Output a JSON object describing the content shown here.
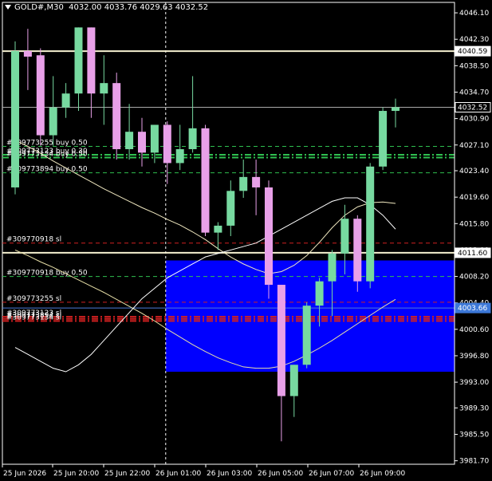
{
  "header": {
    "symbol": "GOLD#,M30",
    "ohlc": "4032.00 4033.76 4029.63 4032.52"
  },
  "colors": {
    "background": "#000000",
    "bull": "#77d9a0",
    "bear": "#e8a0e8",
    "zone": "#0000ff",
    "axis": "#ffffff",
    "grid_dash": "#ffffff",
    "buy_line": "#2fbf4f",
    "sl_line": "#d02020"
  },
  "chart_data": {
    "type": "candlestick",
    "y_ticks": [
      "4046.10",
      "4042.30",
      "4038.50",
      "4034.70",
      "4030.90",
      "4027.10",
      "4023.40",
      "4019.60",
      "4015.80",
      "4012.00",
      "4008.20",
      "4004.40",
      "4000.60",
      "3996.80",
      "3993.00",
      "3989.30",
      "3985.50",
      "3981.70"
    ],
    "x_ticks": [
      "25 Jun 2026",
      "25 Jun 20:00",
      "25 Jun 22:00",
      "26 Jun 01:00",
      "26 Jun 03:00",
      "26 Jun 05:00",
      "26 Jun 07:00",
      "26 Jun 09:00"
    ],
    "ylim": [
      3981.2,
      4047.6
    ],
    "price_labels": [
      {
        "value": 4040.59,
        "text": "4040.59",
        "style": "white-line"
      },
      {
        "value": 4032.52,
        "text": "4032.52",
        "style": "current"
      },
      {
        "value": 4011.6,
        "text": "4011.60",
        "style": "white-line"
      },
      {
        "value": 4003.66,
        "text": "4003.66",
        "style": "blue-line"
      }
    ],
    "candles": [
      {
        "o": 4021.0,
        "h": 4042.0,
        "l": 4020.0,
        "c": 4040.6
      },
      {
        "o": 4040.6,
        "h": 4043.8,
        "l": 4035.0,
        "c": 4039.8
      },
      {
        "o": 4040.0,
        "h": 4041.0,
        "l": 4027.0,
        "c": 4028.5
      },
      {
        "o": 4028.5,
        "h": 4037.0,
        "l": 4027.0,
        "c": 4032.5
      },
      {
        "o": 4032.5,
        "h": 4036.0,
        "l": 4031.0,
        "c": 4034.5
      },
      {
        "o": 4034.5,
        "h": 4044.0,
        "l": 4032.0,
        "c": 4044.0
      },
      {
        "o": 4044.0,
        "h": 4044.0,
        "l": 4031.0,
        "c": 4034.5
      },
      {
        "o": 4034.5,
        "h": 4040.0,
        "l": 4030.0,
        "c": 4036.0
      },
      {
        "o": 4036.0,
        "h": 4037.5,
        "l": 4025.0,
        "c": 4026.5
      },
      {
        "o": 4026.5,
        "h": 4033.0,
        "l": 4025.0,
        "c": 4029.0
      },
      {
        "o": 4029.0,
        "h": 4031.0,
        "l": 4024.0,
        "c": 4026.0
      },
      {
        "o": 4026.0,
        "h": 4030.0,
        "l": 4024.5,
        "c": 4030.0
      },
      {
        "o": 4030.0,
        "h": 4030.5,
        "l": 4021.5,
        "c": 4024.5
      },
      {
        "o": 4024.5,
        "h": 4030.0,
        "l": 4023.5,
        "c": 4026.5
      },
      {
        "o": 4026.5,
        "h": 4037.0,
        "l": 4026.0,
        "c": 4029.5
      },
      {
        "o": 4029.5,
        "h": 4030.0,
        "l": 4014.0,
        "c": 4014.5
      },
      {
        "o": 4014.5,
        "h": 4016.0,
        "l": 4012.0,
        "c": 4015.5
      },
      {
        "o": 4015.5,
        "h": 4022.0,
        "l": 4014.0,
        "c": 4020.5
      },
      {
        "o": 4020.5,
        "h": 4025.0,
        "l": 4019.5,
        "c": 4022.5
      },
      {
        "o": 4022.5,
        "h": 4025.0,
        "l": 4017.0,
        "c": 4021.0
      },
      {
        "o": 4021.0,
        "h": 4022.0,
        "l": 4005.0,
        "c": 4007.0
      },
      {
        "o": 4007.0,
        "h": 4007.0,
        "l": 3984.5,
        "c": 3991.0
      },
      {
        "o": 3991.0,
        "h": 3995.5,
        "l": 3988.0,
        "c": 3995.5
      },
      {
        "o": 3995.5,
        "h": 4004.5,
        "l": 3995.0,
        "c": 4004.0
      },
      {
        "o": 4004.0,
        "h": 4008.0,
        "l": 4001.0,
        "c": 4007.5
      },
      {
        "o": 4007.5,
        "h": 4012.0,
        "l": 4002.5,
        "c": 4011.5
      },
      {
        "o": 4011.5,
        "h": 4018.5,
        "l": 4008.5,
        "c": 4016.5
      },
      {
        "o": 4016.5,
        "h": 4017.0,
        "l": 4006.0,
        "c": 4007.5
      },
      {
        "o": 4007.5,
        "h": 4024.5,
        "l": 4006.5,
        "c": 4024.0
      },
      {
        "o": 4024.0,
        "h": 4032.5,
        "l": 4023.5,
        "c": 4032.0
      },
      {
        "o": 4032.0,
        "h": 4033.76,
        "l": 4029.63,
        "c": 4032.52
      }
    ],
    "ma_slow": [
      4012.0,
      4011.2,
      4010.3,
      4009.5,
      4008.6,
      4007.7,
      4006.8,
      4005.9,
      4004.9,
      4003.9,
      4002.9,
      4001.8,
      4000.6,
      3999.5,
      3998.4,
      3997.4,
      3996.5,
      3995.8,
      3995.2,
      3995.0,
      3995.0,
      3995.3,
      3996.0,
      3996.9,
      3997.9,
      3999.0,
      4000.2,
      4001.4,
      4002.6,
      4003.8,
      4004.9
    ],
    "ma_fast": [
      4027.8,
      4026.9,
      4025.9,
      4024.8,
      4023.8,
      4022.8,
      4021.8,
      4020.8,
      4019.9,
      4019.0,
      4018.1,
      4017.3,
      4016.4,
      4015.6,
      4014.6,
      4013.5,
      4012.2,
      4011.0,
      4010.0,
      4009.2,
      4008.6,
      4008.9,
      4009.8,
      4011.2,
      4013.1,
      4015.2,
      4017.0,
      4018.2,
      4018.8,
      4018.9,
      4018.7
    ],
    "ma_third": [
      3998.0,
      3997.0,
      3996.0,
      3995.0,
      3994.5,
      3995.5,
      3997.0,
      3999.0,
      4001.0,
      4003.0,
      4005.0,
      4006.5,
      4008.0,
      4009.0,
      4010.0,
      4011.0,
      4011.5,
      4012.0,
      4012.5,
      4013.0,
      4014.0,
      4015.0,
      4016.0,
      4017.0,
      4018.0,
      4019.0,
      4019.5,
      4019.5,
      4018.5,
      4017.0,
      4015.0
    ],
    "zone": {
      "top": 4010.5,
      "bottom": 3994.5,
      "start_index": 12
    },
    "vertical_marker_index": 12,
    "trade_lines": [
      {
        "value": 4026.9,
        "label": "#309773255 buy 0.50",
        "kind": "buy-dash"
      },
      {
        "value": 4025.7,
        "label": "#309773123 buy 0.30",
        "kind": "buy-dashdot"
      },
      {
        "value": 4025.3,
        "label": "#309773134 buy 0.50",
        "kind": "buy-dashdot"
      },
      {
        "value": 4023.1,
        "label": "#309773894 buy 0.50",
        "kind": "buy-dash"
      },
      {
        "value": 4013.0,
        "label": "#309770918 sl",
        "kind": "sl-dash"
      },
      {
        "value": 4008.2,
        "label": "#309770918 buy 0.50",
        "kind": "buy-dash"
      },
      {
        "value": 4004.5,
        "label": "#309773255 sl",
        "kind": "sl-dash"
      },
      {
        "value": 4002.4,
        "label": "#309773123 sl",
        "kind": "sl-dashdot"
      },
      {
        "value": 4002.1,
        "label": "#309773894 sl",
        "kind": "sl-dashdot"
      },
      {
        "value": 4001.8,
        "label": "#309773134 sl",
        "kind": "sl-dashdot"
      }
    ]
  }
}
